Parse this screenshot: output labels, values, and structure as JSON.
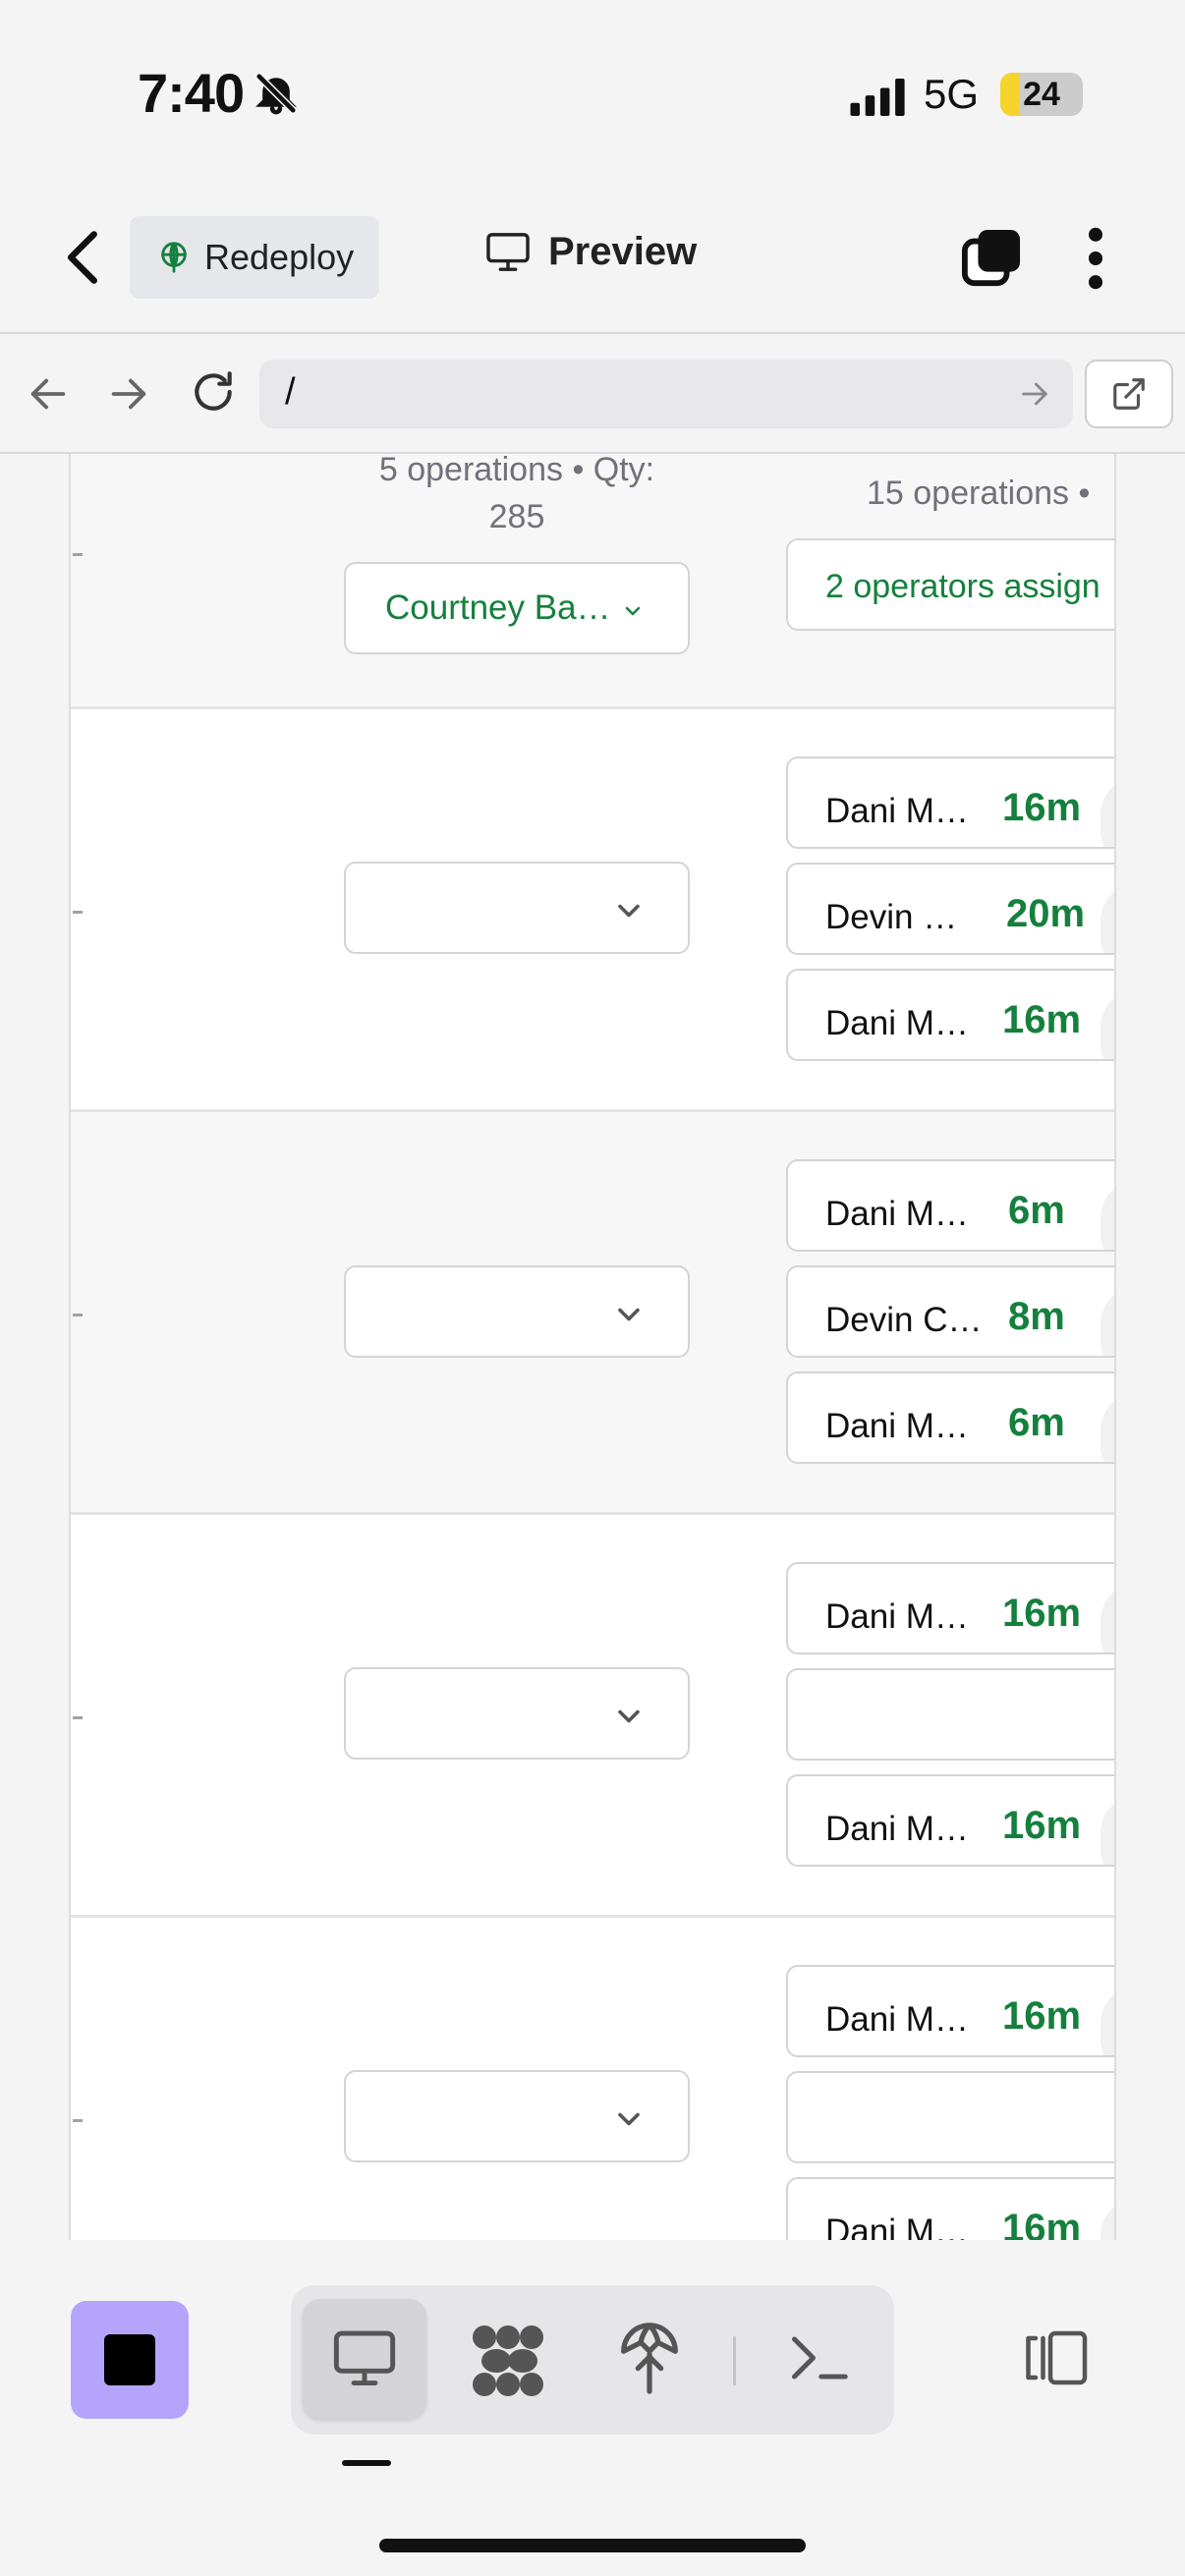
{
  "status_bar": {
    "time": "7:40",
    "network": "5G",
    "battery": "24",
    "battery_level": 0.24
  },
  "header": {
    "redeploy_label": "Redeploy",
    "preview_label": "Preview"
  },
  "browser": {
    "url": "/"
  },
  "summary_row": {
    "left_line1": "5 operations • Qty:",
    "left_line2": "285",
    "right_text": "15 operations •",
    "selected_operator": "Courtney Ba…",
    "assign_label": "2 operators assign"
  },
  "rows": [
    {
      "select_value": "",
      "operations": [
        {
          "name": "Dani M…",
          "duration": "16m"
        },
        {
          "name": "Devin …",
          "duration": "20m"
        },
        {
          "name": "Dani M…",
          "duration": "16m"
        }
      ]
    },
    {
      "select_value": "",
      "operations": [
        {
          "name": "Dani M…",
          "duration": "6m"
        },
        {
          "name": "Devin C…",
          "duration": "8m"
        },
        {
          "name": "Dani M…",
          "duration": "6m"
        }
      ]
    },
    {
      "select_value": "",
      "operations": [
        {
          "name": "Dani M…",
          "duration": "16m"
        },
        {
          "name": "",
          "duration": ""
        },
        {
          "name": "Dani M…",
          "duration": "16m"
        }
      ]
    },
    {
      "select_value": "",
      "operations": [
        {
          "name": "Dani M…",
          "duration": "16m"
        },
        {
          "name": "",
          "duration": ""
        },
        {
          "name": "Dani M…",
          "duration": "16m"
        }
      ]
    }
  ],
  "colors": {
    "accent_green": "#15803d",
    "stop_button": "#b4a4fb",
    "battery_fill": "#f6d32b"
  },
  "icons": [
    "bell-off-icon",
    "signal-icon",
    "back-chevron-icon",
    "redeploy-icon",
    "monitor-icon",
    "windows-icon",
    "more-vertical-icon",
    "arrow-left-icon",
    "arrow-right-icon",
    "reload-icon",
    "external-link-icon",
    "chevron-down-icon",
    "stop-icon",
    "graph-icon",
    "deploy-icon",
    "terminal-icon",
    "panel-toggle-icon"
  ]
}
